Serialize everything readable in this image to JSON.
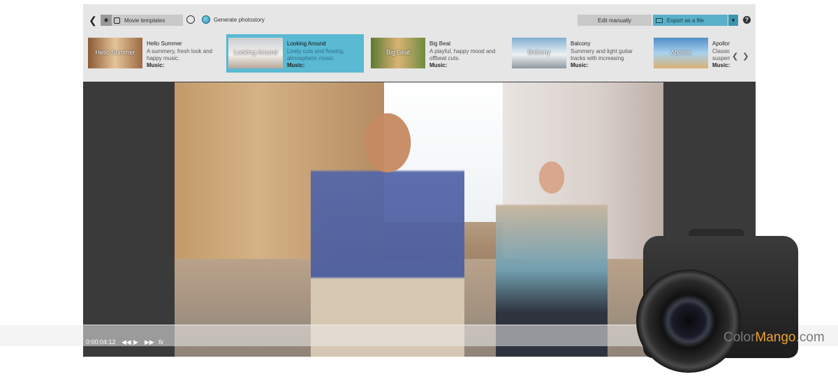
{
  "toolbar": {
    "movie_templates_label": "Movie templates",
    "generate_photostory_label": "Generate photostory",
    "edit_manually_label": "Edit manually",
    "export_label": "Export as a file",
    "help_label": "?"
  },
  "templates": [
    {
      "thumb_label": "Hello Summer",
      "name": "Hello Summer",
      "desc": "A summery, fresh look and happy music.",
      "music": "Music:",
      "selected": false
    },
    {
      "thumb_label": "Looking Around",
      "name": "Looking Around",
      "desc": "Lively cuts and flowing, atmospheric music.",
      "music": "Music:",
      "selected": true
    },
    {
      "thumb_label": "Big Beat",
      "name": "Big Beat",
      "desc": "A playful, happy mood and offbeat cuts.",
      "music": "Music:",
      "selected": false
    },
    {
      "thumb_label": "Balkony",
      "name": "Balcony",
      "desc": "Summery and light guitar tracks with increasing",
      "music": "Music:",
      "selected": false
    },
    {
      "thumb_label": "Apollon",
      "name": "Apollon",
      "desc": "Classic suspen",
      "music": "Music:",
      "selected": false
    }
  ],
  "playback": {
    "time": "0:00:04:12",
    "fx_label": "fx"
  },
  "watermark": {
    "color": "Color",
    "mango": "Mango",
    "suffix": ".com"
  },
  "colors": {
    "selected": "#5ab9d3",
    "export": "#59b0c9",
    "toolbar_bg": "#e6e6e6"
  }
}
